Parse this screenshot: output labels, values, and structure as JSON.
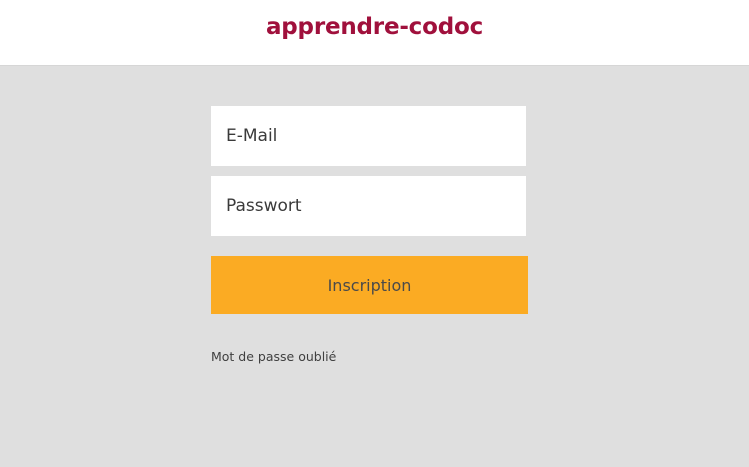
{
  "header": {
    "logo_text": "apprendre-codoc"
  },
  "login_form": {
    "email_placeholder": "E-Mail",
    "password_placeholder": "Passwort",
    "submit_label": "Inscription",
    "forgot_password_link": "Mot de passe oublié"
  },
  "colors": {
    "brand": "#a0103c",
    "button": "#fbab23",
    "background": "#dfdfdf",
    "header_background": "#ffffff"
  }
}
